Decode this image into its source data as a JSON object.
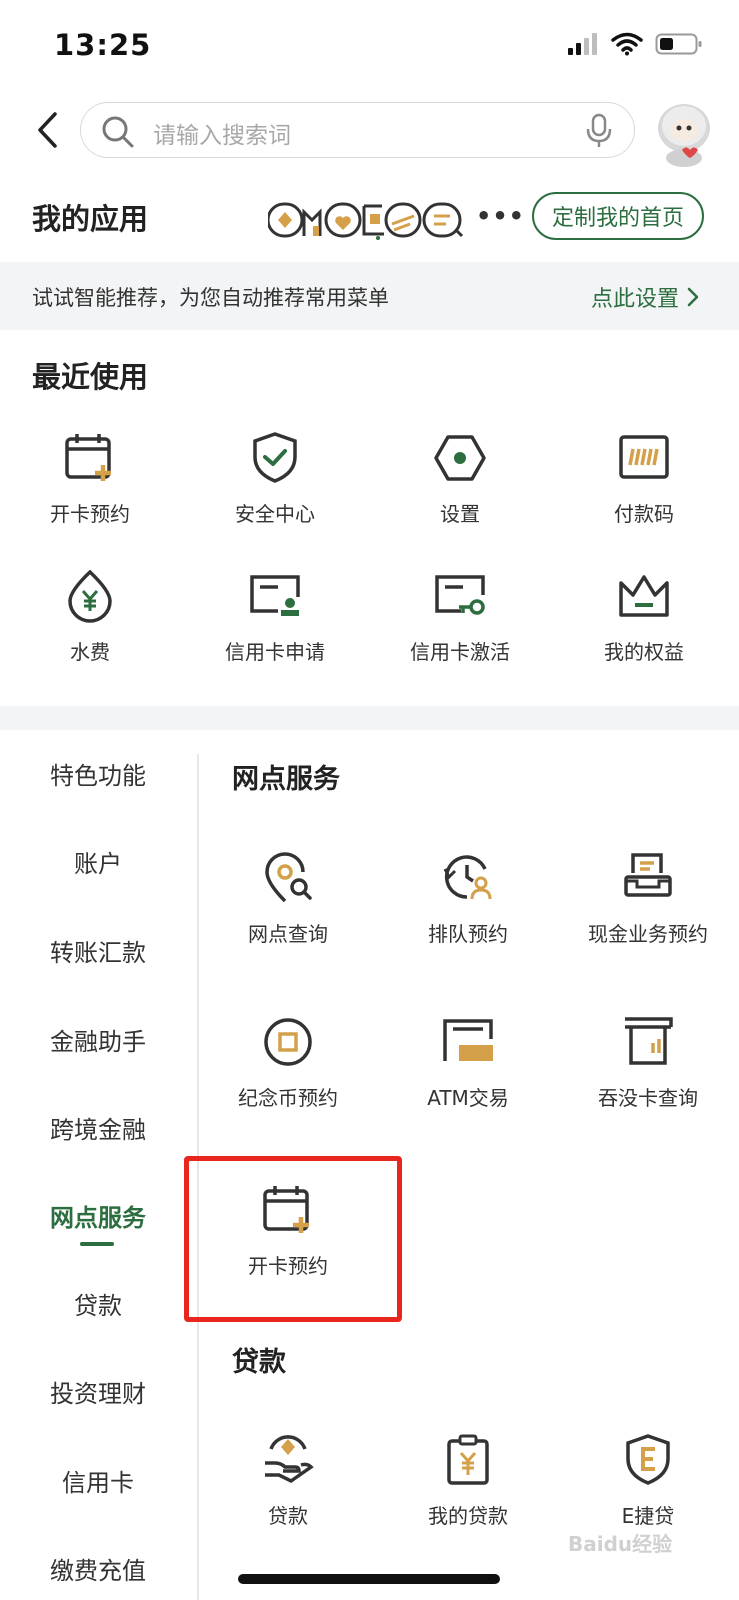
{
  "status": {
    "time": "13:25"
  },
  "search": {
    "placeholder": "请输入搜索词"
  },
  "my_apps": {
    "title": "我的应用",
    "more": "•••",
    "customize_label": "定制我的首页"
  },
  "recommend": {
    "text": "试试智能推荐，为您自动推荐常用菜单",
    "link_label": "点此设置"
  },
  "recent": {
    "title": "最近使用",
    "items": [
      {
        "label": "开卡预约",
        "icon": "calendar-plus-icon"
      },
      {
        "label": "安全中心",
        "icon": "shield-check-icon"
      },
      {
        "label": "设置",
        "icon": "hexagon-settings-icon"
      },
      {
        "label": "付款码",
        "icon": "payment-code-icon"
      },
      {
        "label": "水费",
        "icon": "water-drop-yuan-icon"
      },
      {
        "label": "信用卡申请",
        "icon": "card-stamp-icon"
      },
      {
        "label": "信用卡激活",
        "icon": "card-key-icon"
      },
      {
        "label": "我的权益",
        "icon": "crown-icon"
      }
    ]
  },
  "side_nav": {
    "items": [
      {
        "label": "特色功能"
      },
      {
        "label": "账户"
      },
      {
        "label": "转账汇款"
      },
      {
        "label": "金融助手"
      },
      {
        "label": "跨境金融"
      },
      {
        "label": "网点服务"
      },
      {
        "label": "贷款"
      },
      {
        "label": "投资理财"
      },
      {
        "label": "信用卡"
      },
      {
        "label": "缴费充值"
      }
    ],
    "active_index": 5
  },
  "branch_services": {
    "title": "网点服务",
    "items": [
      {
        "label": "网点查询",
        "icon": "location-search-icon"
      },
      {
        "label": "排队预约",
        "icon": "queue-clock-icon"
      },
      {
        "label": "现金业务预约",
        "icon": "cash-machine-icon"
      },
      {
        "label": "纪念币预约",
        "icon": "coin-icon"
      },
      {
        "label": "ATM交易",
        "icon": "atm-icon",
        "badge": "ATM"
      },
      {
        "label": "吞没卡查询",
        "icon": "card-slot-icon"
      },
      {
        "label": "开卡预约",
        "icon": "calendar-plus-icon"
      }
    ]
  },
  "loans": {
    "title": "贷款",
    "items": [
      {
        "label": "贷款",
        "icon": "hand-coin-icon"
      },
      {
        "label": "我的贷款",
        "icon": "clipboard-yuan-icon"
      },
      {
        "label": "E捷贷",
        "icon": "shield-e-icon",
        "badge": "E"
      }
    ]
  },
  "watermark": "Baidu经验",
  "colors": {
    "brand_green": "#2c6e3f",
    "accent_gold": "#d4a04a",
    "highlight_red": "#e8261e",
    "icon_dark": "#333333"
  }
}
